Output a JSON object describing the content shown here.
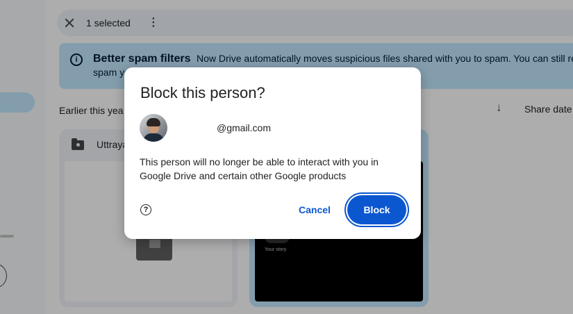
{
  "selection_bar": {
    "count_label": "1 selected"
  },
  "spam_banner": {
    "title": "Better spam filters",
    "text": "Now Drive automatically moves suspicious files shared with you to spam. You can still report",
    "text_line2": "spam yo"
  },
  "section": {
    "heading": "Earlier this yea",
    "sort_label": "Share date"
  },
  "cards": [
    {
      "title": "Uttraya"
    }
  ],
  "story_label": "Your story",
  "dialog": {
    "title": "Block this person?",
    "email": "@gmail.com",
    "message": "This person will no longer be able to interact with you in Google Drive and certain other Google products",
    "help_icon_glyph": "?",
    "cancel_label": "Cancel",
    "block_label": "Block"
  },
  "colors": {
    "accent": "#0b57d0",
    "banner": "#c2e7ff",
    "scrim": "rgba(0,0,0,0.32)"
  }
}
